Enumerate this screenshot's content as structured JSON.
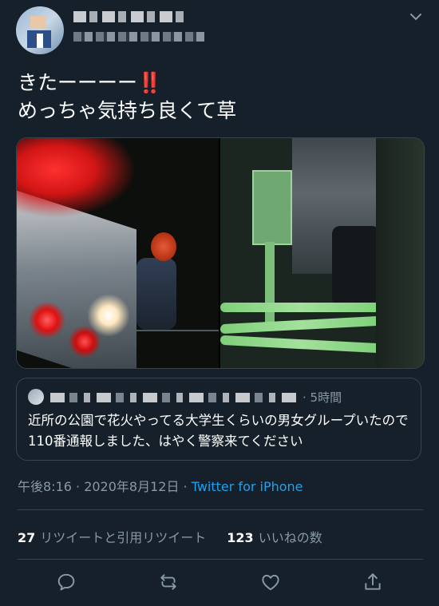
{
  "tweet": {
    "text_line1": "きたーーーー",
    "bang": "‼️",
    "text_line2": "めっちゃ気持ち良くて草",
    "timestamp": "午後8:16 · 2020年8月12日 · ",
    "source": "Twitter for iPhone"
  },
  "quoted": {
    "time": "· 5時間",
    "text": "近所の公園で花火やってる大学生くらいの男女グループいたので110番通報しました、はやく警察来てください"
  },
  "stats": {
    "retweets_count": "27",
    "retweets_label": "リツイートと引用リツイート",
    "likes_count": "123",
    "likes_label": "いいねの数"
  },
  "colors": {
    "background": "#15202b",
    "accent": "#1da1f2",
    "muted": "#8899a6",
    "border": "#38444d"
  },
  "icons": {
    "menu": "chevron-down-icon",
    "reply": "reply-icon",
    "retweet": "retweet-icon",
    "like": "heart-icon",
    "share": "share-icon"
  }
}
